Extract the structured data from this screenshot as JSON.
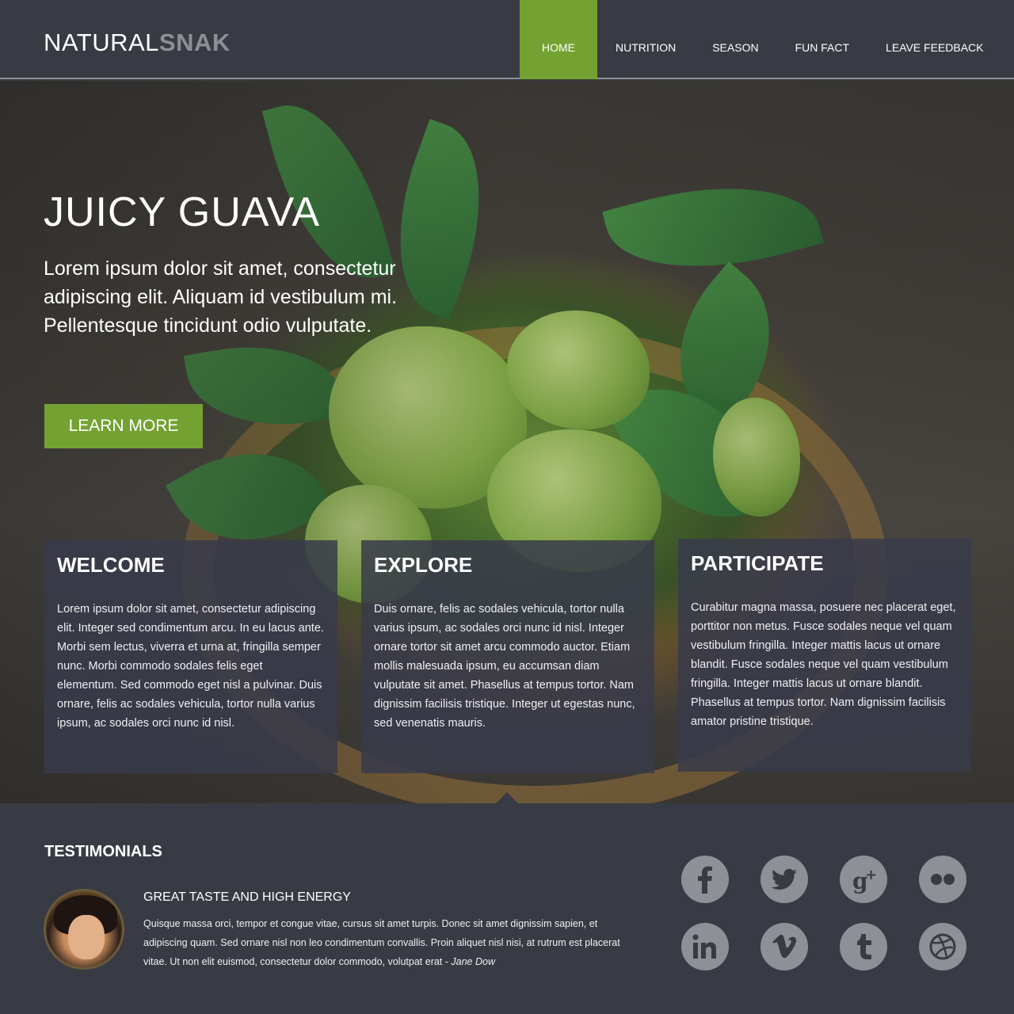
{
  "brand": {
    "part1": "NATURAL",
    "part2": "SNAK"
  },
  "nav": {
    "items": [
      {
        "label": "HOME",
        "active": true
      },
      {
        "label": "NUTRITION",
        "active": false
      },
      {
        "label": "SEASON",
        "active": false
      },
      {
        "label": "FUN FACT",
        "active": false
      },
      {
        "label": "LEAVE FEEDBACK",
        "active": false
      }
    ]
  },
  "hero": {
    "title": "JUICY GUAVA",
    "text": "Lorem ipsum dolor sit amet, consectetur adipiscing elit. Aliquam id vestibulum mi. Pellentesque tincidunt odio vulputate.",
    "cta": "LEARN MORE"
  },
  "cards": [
    {
      "title": "WELCOME",
      "text": "Lorem ipsum dolor sit amet, consectetur adipiscing elit. Integer sed condimentum arcu. In eu lacus ante. Morbi sem lectus, viverra et urna at, fringilla semper nunc. Morbi commodo sodales felis eget elementum. Sed commodo eget nisl a pulvinar. Duis ornare, felis ac sodales vehicula, tortor nulla varius ipsum, ac sodales orci nunc id nisl."
    },
    {
      "title": "EXPLORE",
      "text": "Duis ornare, felis ac sodales vehicula, tortor nulla varius ipsum, ac sodales orci nunc id nisl. Integer ornare tortor sit amet arcu commodo auctor. Etiam mollis malesuada ipsum, eu accumsan diam vulputate sit amet. Phasellus at tempus tortor. Nam dignissim facilisis tristique. Integer ut egestas nunc, sed venenatis mauris."
    },
    {
      "title": "PARTICIPATE",
      "text": "Curabitur magna massa, posuere nec placerat eget, porttitor non metus. Fusce sodales neque vel quam vestibulum fringilla. Integer mattis lacus ut ornare blandit. Fusce sodales neque vel quam vestibulum fringilla. Integer mattis lacus ut ornare blandit. Phasellus at tempus tortor. Nam dignissim facilisis amator pristine tristique."
    }
  ],
  "testimonials": {
    "title": "TESTIMONIALS",
    "quote_title": "GREAT TASTE AND HIGH ENERGY",
    "quote_text": "Quisque massa orci, tempor et congue vitae, cursus sit amet turpis. Donec sit amet dignissim sapien, et adipiscing quam. Sed ornare nisl non leo condimentum convallis. Proin aliquet nisl nisi, at rutrum est placerat vitae. Ut non elit euismod, consectetur dolor commodo, volutpat erat - ",
    "author": "Jane Dow"
  },
  "social": [
    {
      "name": "facebook-icon",
      "glyph": "f"
    },
    {
      "name": "twitter-icon",
      "glyph": "🐦"
    },
    {
      "name": "google-plus-icon",
      "glyph": "g+"
    },
    {
      "name": "flickr-icon",
      "glyph": "●●"
    },
    {
      "name": "linkedin-icon",
      "glyph": "in"
    },
    {
      "name": "vimeo-icon",
      "glyph": "v"
    },
    {
      "name": "tumblr-icon",
      "glyph": "t"
    },
    {
      "name": "dribbble-icon",
      "glyph": "◍"
    }
  ],
  "colors": {
    "accent": "#74a232",
    "dark": "#383b43",
    "icon": "#8e9096"
  }
}
